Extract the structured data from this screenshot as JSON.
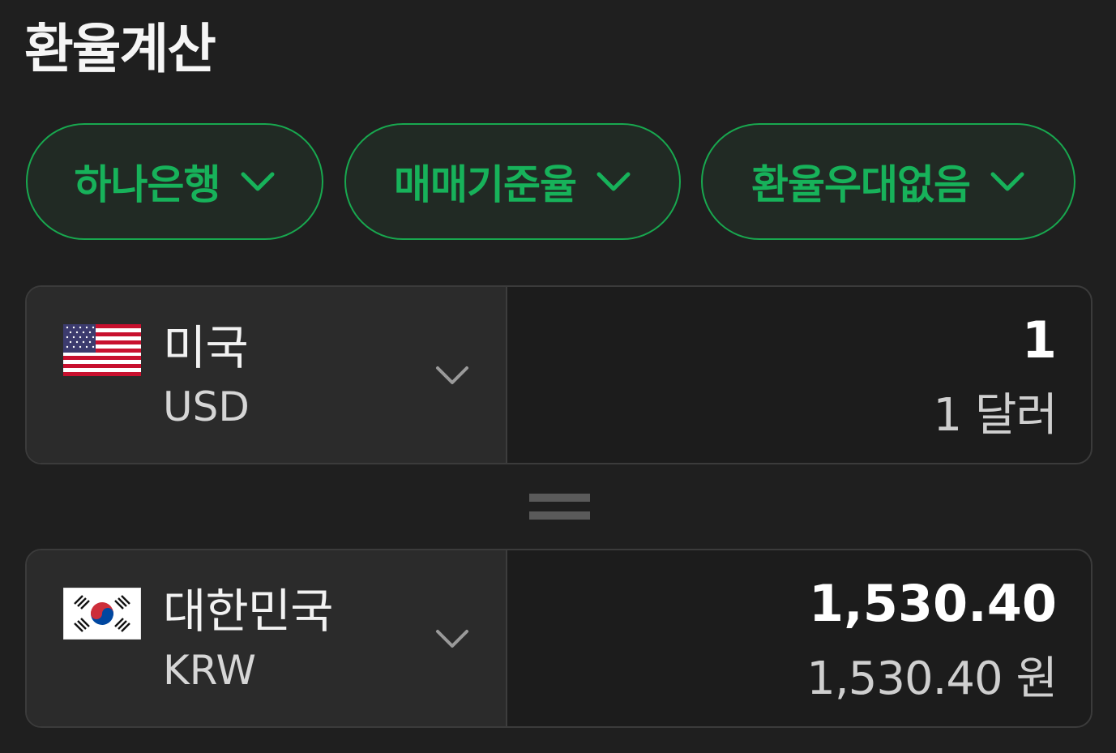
{
  "header": {
    "title": "환율계산"
  },
  "filters": {
    "bank": "하나은행",
    "rate_type": "매매기준율",
    "preference": "환율우대없음"
  },
  "from": {
    "flag_icon": "us-flag-icon",
    "country": "미국",
    "currency_code": "USD",
    "amount": "1",
    "amount_words": "1 달러"
  },
  "to": {
    "flag_icon": "kr-flag-icon",
    "country": "대한민국",
    "currency_code": "KRW",
    "amount": "1,530.40",
    "amount_words": "1,530.40 원"
  },
  "colors": {
    "background": "#1f1f1f",
    "accent": "#17b25a",
    "card_border": "#3b3b3b"
  }
}
